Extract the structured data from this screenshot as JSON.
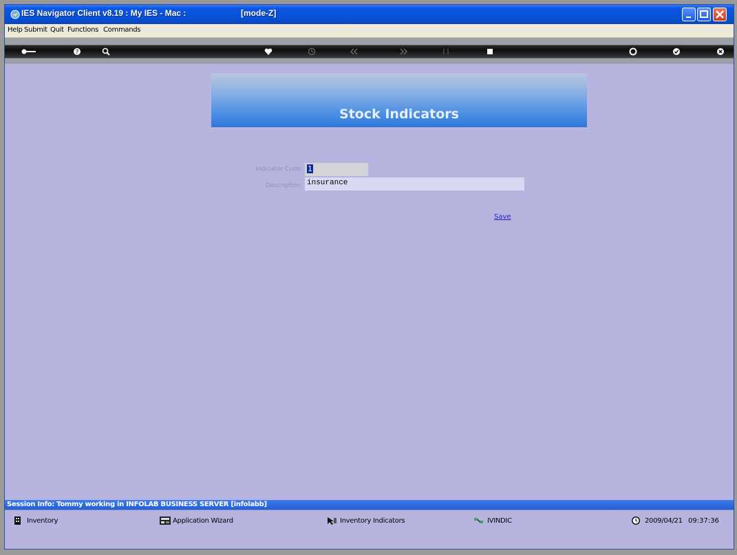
{
  "window": {
    "title": "IES Navigator Client v8.19 : My IES - Mac :",
    "mode": "[mode-Z]"
  },
  "menu": {
    "items": [
      "Help",
      "Submit",
      "Quit",
      "Functions",
      "Commands"
    ]
  },
  "toolbar": {
    "icons": [
      "key-icon",
      "help-icon",
      "search-icon",
      "heart-icon",
      "clock-icon",
      "rewind-icon",
      "fast-forward-icon",
      "sort-icon",
      "stop-icon",
      "ring-icon",
      "check-icon",
      "close-icon"
    ]
  },
  "form": {
    "title": "Stock Indicators",
    "indicator_code_label": "Indicator Code",
    "indicator_code_value": "1",
    "description_label": "Description",
    "description_value": "insurance",
    "save_label": "Save"
  },
  "session": {
    "info": "Session Info: Tommy working in INFOLAB BUSINESS SERVER  [infolabb]"
  },
  "taskbar": {
    "items": [
      {
        "label": "Inventory",
        "icon": "building-icon"
      },
      {
        "label": "Application Wizard",
        "icon": "wizard-icon"
      },
      {
        "label": "Inventory Indicators",
        "icon": "pointer-icon"
      },
      {
        "label": "IVINDIC",
        "icon": "network-icon"
      }
    ],
    "date": "2009/04/21",
    "time": "09:37:36"
  },
  "colors": {
    "titlebar": "#0850d8",
    "background": "#b7b5df",
    "session_bar": "#1f5fd6",
    "link": "#2020c8"
  }
}
